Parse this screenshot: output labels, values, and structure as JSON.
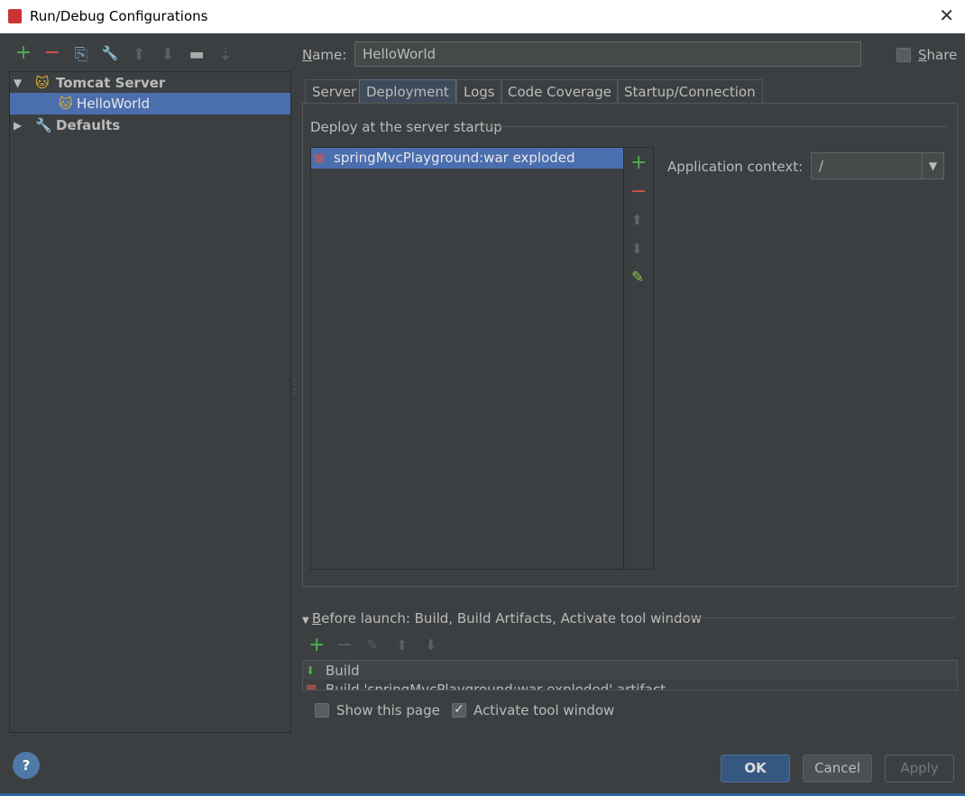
{
  "window": {
    "title": "Run/Debug Configurations",
    "close": "✕"
  },
  "toolbar": {
    "add": "+",
    "remove": "−",
    "copy": "⎘",
    "edit": "🔧",
    "up": "⬆",
    "down": "⬇",
    "folder": "▬",
    "sort": "⇣"
  },
  "tree": [
    {
      "label": "Tomcat Server",
      "expanded": true,
      "icon": "tomcat-icon"
    },
    {
      "label": "HelloWorld",
      "selected": true,
      "icon": "tomcat-icon"
    },
    {
      "label": "Defaults",
      "expanded": false,
      "icon": "wrench-icon"
    }
  ],
  "name": {
    "label_u": "N",
    "label_rest": "ame:",
    "value": "HelloWorld"
  },
  "share": {
    "label_u": "S",
    "label_rest": "hare",
    "checked": false
  },
  "tabs": [
    {
      "label": "Server"
    },
    {
      "label": "Deployment",
      "active": true
    },
    {
      "label": "Logs"
    },
    {
      "label": "Code Coverage"
    },
    {
      "label": "Startup/Connection"
    }
  ],
  "deploy": {
    "heading": "Deploy at the server startup",
    "items": [
      "springMvcPlayground:war exploded"
    ],
    "context_label": "Application context:",
    "context_value": "/"
  },
  "side_buttons": {
    "add": "+",
    "remove": "−",
    "up": "⬆",
    "down": "⬇",
    "edit": "✎"
  },
  "before_launch": {
    "label_u": "B",
    "label_rest": "efore launch: Build, Build Artifacts, Activate tool window",
    "items": [
      "Build",
      "Build 'springMvcPlayground:war exploded' artifact"
    ]
  },
  "options": {
    "show_page": {
      "label": "Show this page",
      "checked": false
    },
    "activate": {
      "label": "Activate tool window",
      "checked": true
    }
  },
  "footer": {
    "help": "?",
    "ok": "OK",
    "cancel": "Cancel",
    "apply": "Apply"
  },
  "colors": {
    "accent": "#4b6eaf",
    "background": "#3c3f41"
  }
}
